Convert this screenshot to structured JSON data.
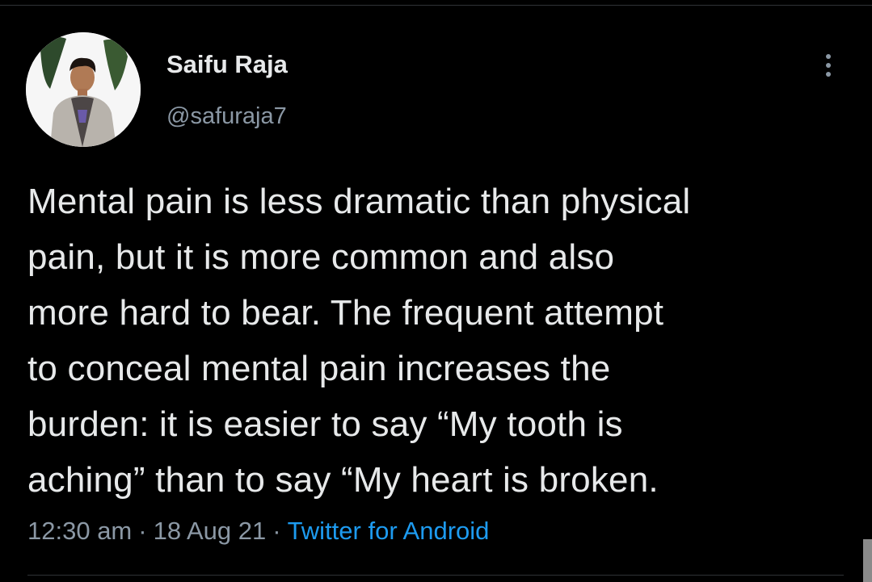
{
  "tweet": {
    "author": {
      "display_name": "Saifu Raja",
      "handle": "@safuraja7"
    },
    "more_icon": "more-vertical-icon",
    "text_lines": [
      "Mental pain is less dramatic than physical",
      "pain, but it is more common and also",
      "more hard to bear. The frequent attempt",
      "to conceal mental pain increases the",
      "burden: it is easier to say “My tooth is",
      "aching” than to say “My heart is broken."
    ],
    "meta": {
      "time": "12:30 am",
      "separator": "·",
      "date": "18 Aug 21",
      "source": "Twitter for Android"
    }
  },
  "colors": {
    "background": "#000000",
    "text": "#e7e9ea",
    "secondary_text": "#8b98a5",
    "link": "#1d9bf0"
  }
}
